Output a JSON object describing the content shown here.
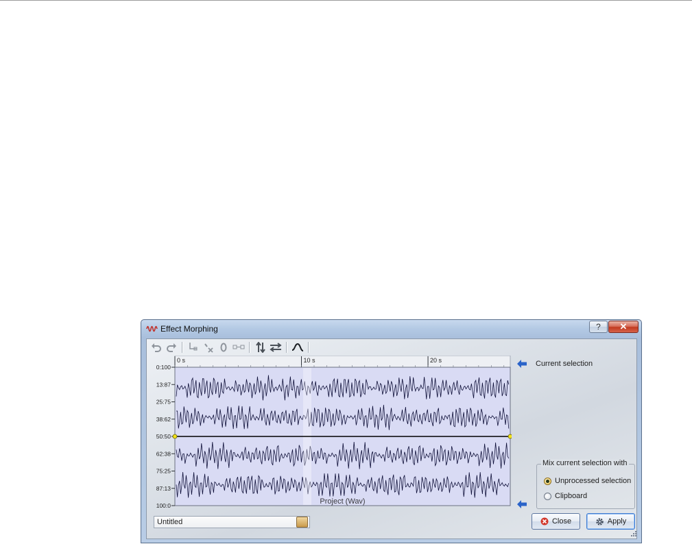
{
  "window": {
    "title": "Effect Morphing",
    "help_glyph": "?",
    "close_glyph": "✕"
  },
  "toolbar": {
    "icons": [
      "undo-icon",
      "redo-icon",
      "add-point-icon",
      "delete-point-icon",
      "reset-zero-icon",
      "link-points-icon",
      "flip-vertical-icon",
      "flip-horizontal-icon",
      "curve-mode-icon"
    ]
  },
  "chart_data": {
    "type": "line",
    "x_ticks": [
      "0 s",
      "10 s",
      "20 s"
    ],
    "y_ticks": [
      "0:100",
      "13:87",
      "25:75",
      "38:62",
      "50:50",
      "62:38",
      "75:25",
      "87:13",
      "100:0"
    ],
    "morph_curve": [
      {
        "x": 0,
        "y": 50
      },
      {
        "x": 26.5,
        "y": 50
      }
    ],
    "xlim": [
      0,
      26.5
    ],
    "background_label": "Project (Wav)"
  },
  "right_panel": {
    "current_selection_label": "Current selection"
  },
  "mix_group": {
    "legend": "Mix current selection with",
    "options": [
      {
        "label": "Unprocessed selection",
        "checked": true
      },
      {
        "label": "Clipboard",
        "checked": false
      }
    ]
  },
  "preset": {
    "value": "Untitled"
  },
  "buttons": {
    "close_label": "Close",
    "apply_label": "Apply"
  },
  "colors": {
    "waveform_bg": "#d9dbf4",
    "waveform_line": "#0e0f38",
    "arrow_blue": "#2a63c9",
    "handle_yellow": "#f2e21a"
  }
}
